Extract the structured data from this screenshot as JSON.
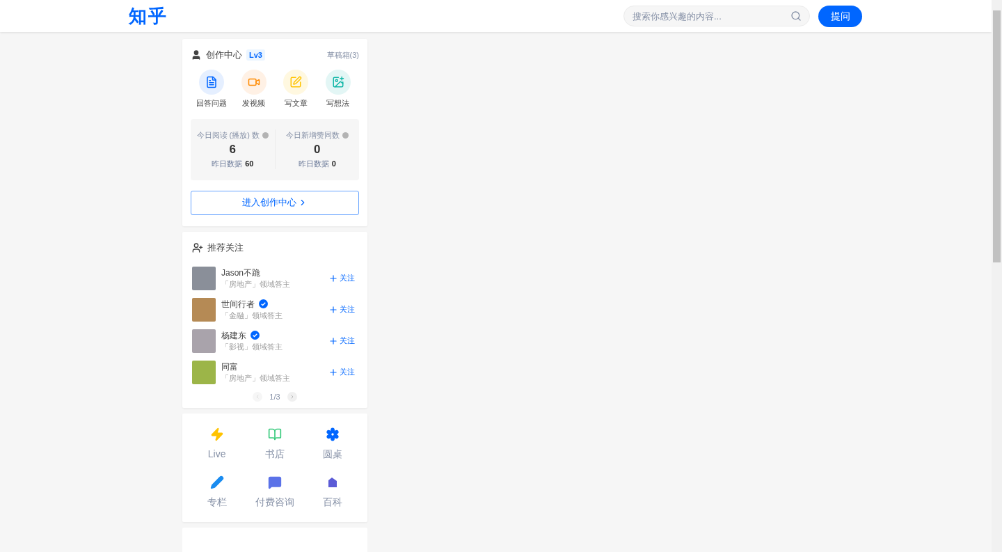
{
  "header": {
    "logo": "知乎",
    "search": {
      "placeholder": "搜索你感兴趣的内容..."
    },
    "ask_button": "提问"
  },
  "creation_center": {
    "title": "创作中心",
    "level_badge": "Lv3",
    "drafts_link": "草稿箱(3)",
    "actions": [
      {
        "kind": "answer",
        "label": "回答问题"
      },
      {
        "kind": "video",
        "label": "发视频"
      },
      {
        "kind": "article",
        "label": "写文章"
      },
      {
        "kind": "idea",
        "label": "写想法"
      }
    ],
    "stats": [
      {
        "label": "今日阅读 (播放) 数",
        "value": "6",
        "yesterday_label": "昨日数据",
        "yesterday_value": "60"
      },
      {
        "label": "今日新增赞同数",
        "value": "0",
        "yesterday_label": "昨日数据",
        "yesterday_value": "0"
      }
    ],
    "enter_button": "进入创作中心"
  },
  "recommended": {
    "title": "推荐关注",
    "users": [
      {
        "name": "Jason不跪",
        "verified": false,
        "field": "「房地产」领域答主",
        "follow": "关注"
      },
      {
        "name": "世间行者",
        "verified": true,
        "field": "「金融」领域答主",
        "follow": "关注"
      },
      {
        "name": "杨建东",
        "verified": true,
        "field": "「影视」领域答主",
        "follow": "关注"
      },
      {
        "name": "同富",
        "verified": false,
        "field": "「房地产」领域答主",
        "follow": "关注"
      }
    ],
    "pager": "1/3"
  },
  "shortcuts": [
    {
      "kind": "live",
      "label": "Live"
    },
    {
      "kind": "bookstore",
      "label": "书店"
    },
    {
      "kind": "roundtable",
      "label": "圆桌"
    },
    {
      "kind": "column",
      "label": "专栏"
    },
    {
      "kind": "consult",
      "label": "付费咨询"
    },
    {
      "kind": "wiki",
      "label": "百科"
    }
  ]
}
